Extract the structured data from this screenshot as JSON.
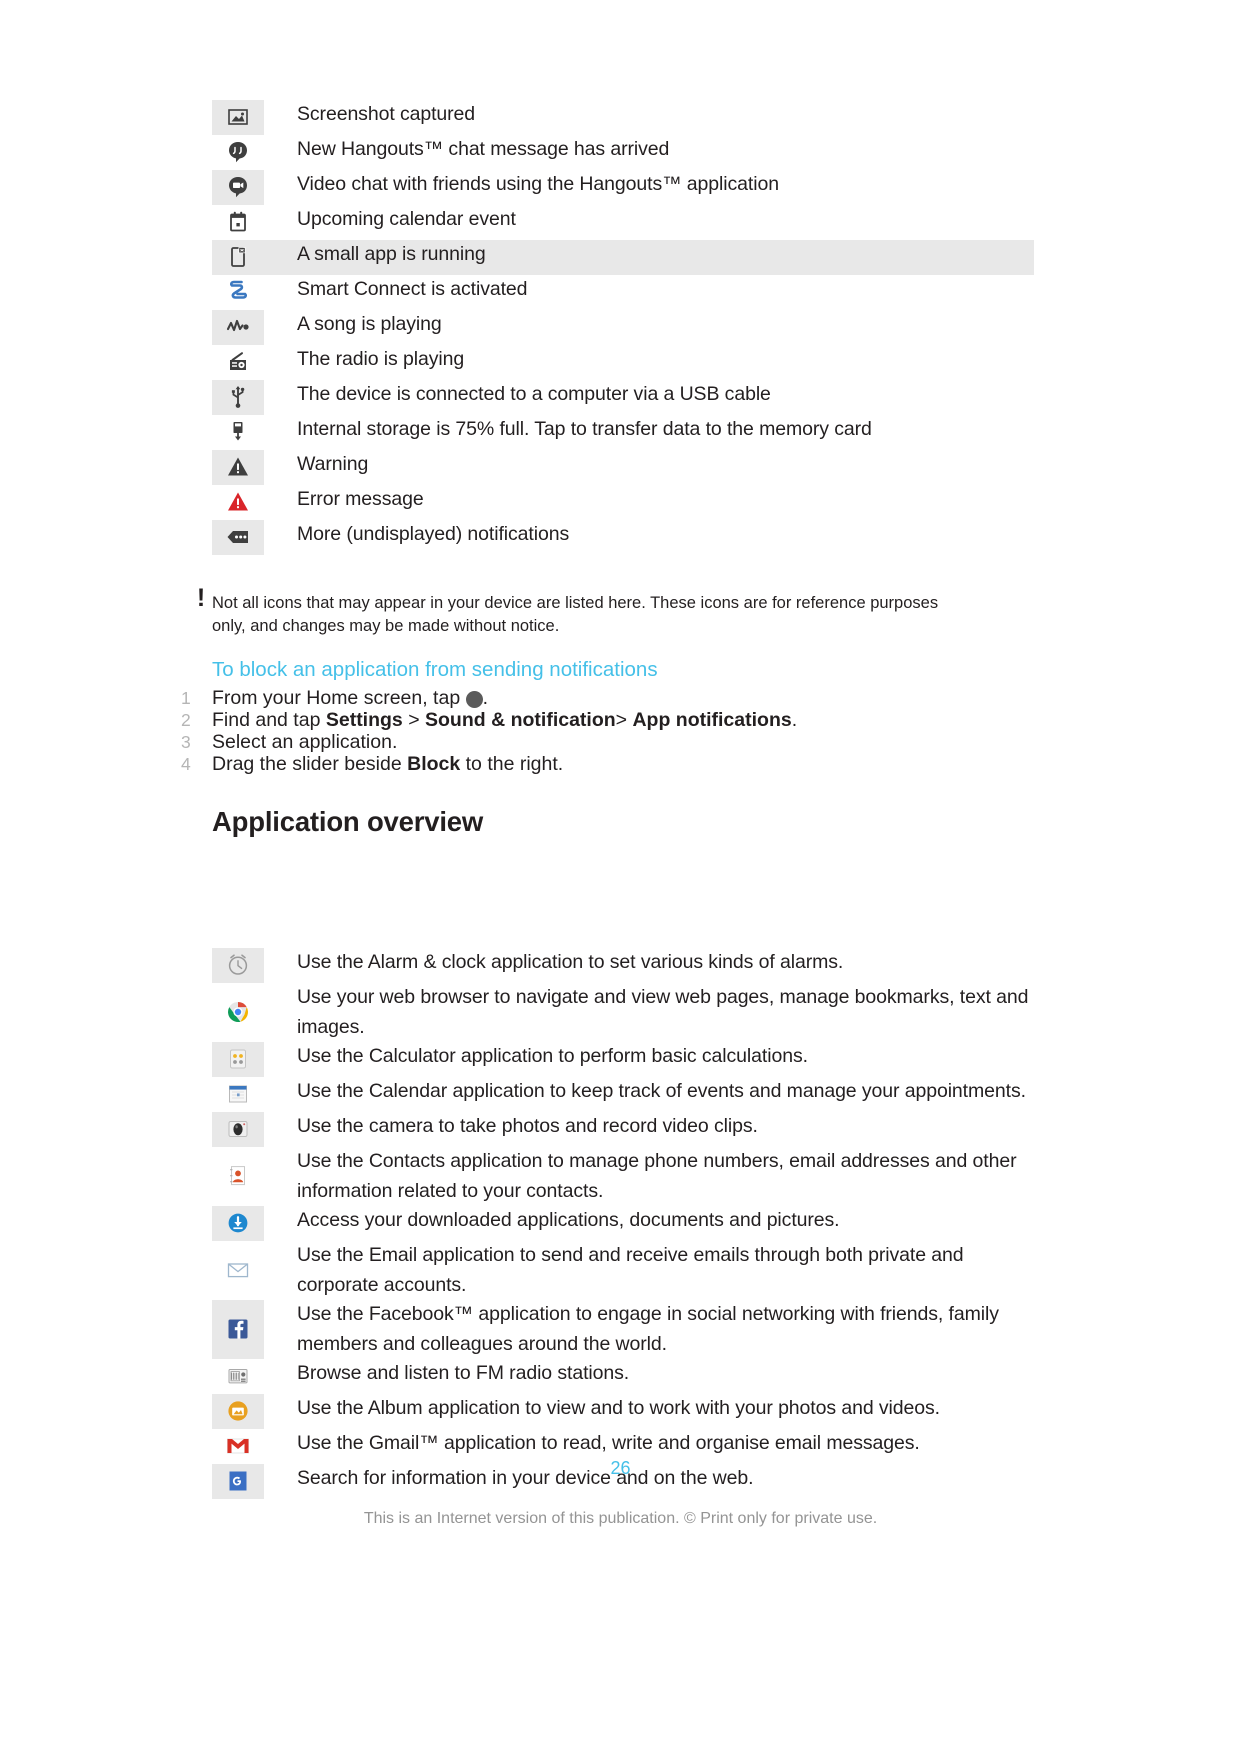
{
  "notification_icons": {
    "rows": [
      {
        "icon": "screenshot-image-icon",
        "text": "Screenshot captured",
        "shaded": "icon"
      },
      {
        "icon": "hangouts-chat-icon",
        "text": "New Hangouts™ chat message has arrived",
        "shaded": "none"
      },
      {
        "icon": "hangouts-video-chat-icon",
        "text": "Video chat with friends using the Hangouts™ application",
        "shaded": "icon"
      },
      {
        "icon": "calendar-event-icon",
        "text": "Upcoming calendar event",
        "shaded": "none"
      },
      {
        "icon": "small-app-icon",
        "text": "A small app is running",
        "shaded": "full"
      },
      {
        "icon": "smart-connect-icon",
        "text": "Smart Connect is activated",
        "shaded": "none"
      },
      {
        "icon": "music-note-icon",
        "text": "A song is playing",
        "shaded": "icon"
      },
      {
        "icon": "radio-icon",
        "text": "The radio is playing",
        "shaded": "none"
      },
      {
        "icon": "usb-icon",
        "text": "The device is connected to a computer via a USB cable",
        "shaded": "icon"
      },
      {
        "icon": "internal-storage-icon",
        "text": "Internal storage is 75% full. Tap to transfer data to the memory card",
        "shaded": "none"
      },
      {
        "icon": "warning-icon",
        "text": "Warning",
        "shaded": "icon"
      },
      {
        "icon": "error-icon",
        "text": "Error message",
        "shaded": "none"
      },
      {
        "icon": "more-notifications-icon",
        "text": "More (undisplayed) notifications",
        "shaded": "icon"
      }
    ]
  },
  "note": {
    "marker": "!",
    "text": "Not all icons that may appear in your device are listed here. These icons are for reference purposes only, and changes may be made without notice."
  },
  "procedure": {
    "heading": "To block an application from sending notifications",
    "steps": [
      {
        "number": "1",
        "prefix": "From your Home screen, tap ",
        "icon": "app-launcher-icon",
        "suffix": "."
      },
      {
        "number": "2",
        "segments": [
          {
            "t": "Find and tap ",
            "bold": false
          },
          {
            "t": "Settings",
            "bold": true
          },
          {
            "t": " > ",
            "bold": false
          },
          {
            "t": "Sound & notification",
            "bold": true
          },
          {
            "t": "> ",
            "bold": false
          },
          {
            "t": "App notifications",
            "bold": true
          },
          {
            "t": ".",
            "bold": false
          }
        ]
      },
      {
        "number": "3",
        "segments": [
          {
            "t": "Select an application.",
            "bold": false
          }
        ]
      },
      {
        "number": "4",
        "segments": [
          {
            "t": "Drag the slider beside ",
            "bold": false
          },
          {
            "t": "Block",
            "bold": true
          },
          {
            "t": " to the right.",
            "bold": false
          }
        ]
      }
    ]
  },
  "section": {
    "title": "Application overview"
  },
  "application_overview": {
    "rows": [
      {
        "icon": "alarm-clock-icon",
        "text": "Use the Alarm & clock application to set various kinds of alarms.",
        "shaded": "icon"
      },
      {
        "icon": "chrome-browser-icon",
        "text": "Use your web browser to navigate and view web pages, manage bookmarks, text and images.",
        "shaded": "none"
      },
      {
        "icon": "calculator-icon",
        "text": "Use the Calculator application to perform basic calculations.",
        "shaded": "icon"
      },
      {
        "icon": "calendar-app-icon",
        "text": "Use the Calendar application to keep track of events and manage your appointments.",
        "shaded": "none"
      },
      {
        "icon": "camera-icon",
        "text": "Use the camera to take photos and record video clips.",
        "shaded": "icon"
      },
      {
        "icon": "contacts-icon",
        "text": "Use the Contacts application to manage phone numbers, email addresses and other information related to your contacts.",
        "shaded": "none"
      },
      {
        "icon": "downloads-icon",
        "text": "Access your downloaded applications, documents and pictures.",
        "shaded": "icon"
      },
      {
        "icon": "email-icon",
        "text": "Use the Email application to send and receive emails through both private and corporate accounts.",
        "shaded": "none"
      },
      {
        "icon": "facebook-icon",
        "text": "Use the Facebook™ application to engage in social networking with friends, family members and colleagues around the world.",
        "shaded": "icon"
      },
      {
        "icon": "fm-radio-icon",
        "text": "Browse and listen to FM radio stations.",
        "shaded": "none"
      },
      {
        "icon": "album-icon",
        "text": "Use the Album application to view and to work with your photos and videos.",
        "shaded": "icon"
      },
      {
        "icon": "gmail-icon",
        "text": "Use the Gmail™ application to read, write and organise email messages.",
        "shaded": "none"
      },
      {
        "icon": "google-search-icon",
        "text": "Search for information in your device and on the web.",
        "shaded": "icon"
      }
    ]
  },
  "footer": {
    "page_number": "26",
    "note": "This is an Internet version of this publication. © Print only for private use."
  },
  "colors": {
    "accent": "#45c0e8",
    "text": "#231f20",
    "shade": "#e8e8e8",
    "step_number": "#b5b5b5",
    "footer_note": "#949494",
    "error_red": "#d9252a"
  }
}
